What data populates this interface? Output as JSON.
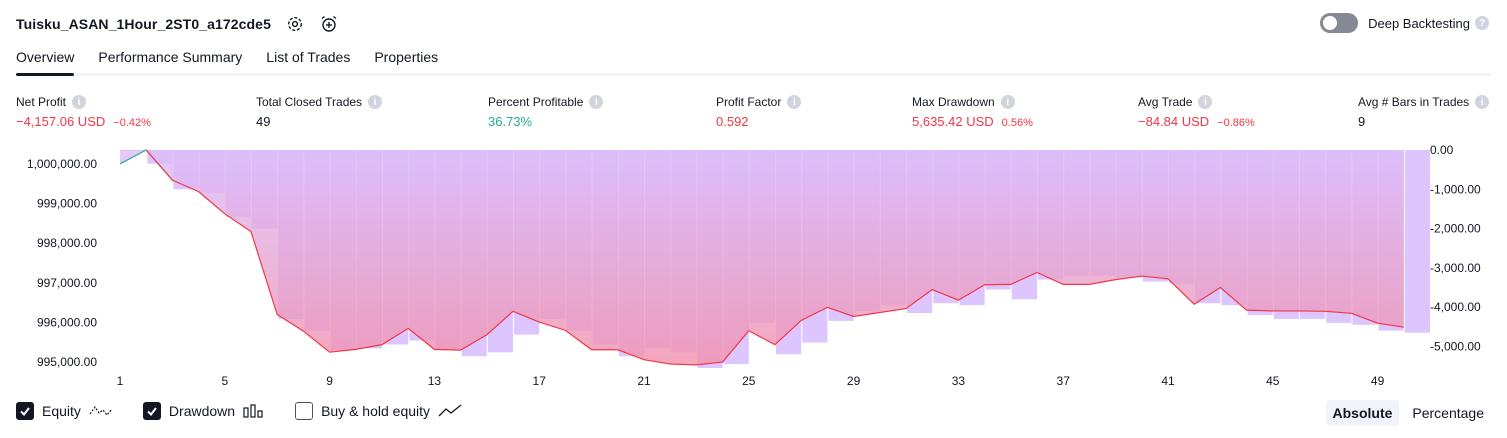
{
  "header": {
    "strategy_name": "Tuisku_ASAN_1Hour_2ST0_a172cde5",
    "settings_icon": "gear-icon",
    "alert_icon": "alarm-clock-add-icon"
  },
  "deep_backtesting": {
    "label": "Deep Backtesting",
    "enabled": false
  },
  "tabs": [
    {
      "label": "Overview",
      "active": true
    },
    {
      "label": "Performance Summary",
      "active": false
    },
    {
      "label": "List of Trades",
      "active": false
    },
    {
      "label": "Properties",
      "active": false
    }
  ],
  "metrics": [
    {
      "label": "Net Profit",
      "value": "−4,157.06 USD",
      "sub": "−0.42%",
      "color": "#f23645"
    },
    {
      "label": "Total Closed Trades",
      "value": "49",
      "sub": "",
      "color": "#131722"
    },
    {
      "label": "Percent Profitable",
      "value": "36.73%",
      "sub": "",
      "color": "#22ab94"
    },
    {
      "label": "Profit Factor",
      "value": "0.592",
      "sub": "",
      "color": "#f23645"
    },
    {
      "label": "Max Drawdown",
      "value": "5,635.42 USD",
      "sub": "0.56%",
      "color": "#f23645"
    },
    {
      "label": "Avg Trade",
      "value": "−84.84 USD",
      "sub": "−0.86%",
      "color": "#f23645"
    },
    {
      "label": "Avg # Bars in Trades",
      "value": "9",
      "sub": "",
      "color": "#131722"
    }
  ],
  "legend": {
    "equity": {
      "label": "Equity",
      "checked": true
    },
    "drawdown": {
      "label": "Drawdown",
      "checked": true
    },
    "buy_hold": {
      "label": "Buy & hold equity",
      "checked": false
    }
  },
  "mode": {
    "absolute": "Absolute",
    "percentage": "Percentage",
    "active": "Absolute"
  },
  "chart_data": {
    "type": "area",
    "x_ticks": [
      "1",
      "5",
      "9",
      "13",
      "17",
      "21",
      "25",
      "29",
      "33",
      "37",
      "41",
      "45",
      "49"
    ],
    "left_axis": {
      "ticks": [
        "1,000,000.00",
        "999,000.00",
        "998,000.00",
        "997,000.00",
        "996,000.00",
        "995,000.00"
      ],
      "range": [
        994800,
        1000350
      ]
    },
    "right_axis": {
      "ticks": [
        "0.00",
        "-1,000.00",
        "-2,000.00",
        "-3,000.00",
        "-4,000.00",
        "-5,000.00"
      ],
      "range": [
        -5600,
        0
      ]
    },
    "colors": {
      "equity_below": "#f23645",
      "equity_above": "#22ab94",
      "drawdown": "#d1b3ff",
      "fill_top": "#dcbcfb",
      "fill_bottom": "#f191ad"
    },
    "series": [
      {
        "name": "Equity",
        "x": [
          0,
          1,
          2,
          3,
          4,
          5,
          6,
          7,
          8,
          9,
          10,
          11,
          12,
          13,
          14,
          15,
          16,
          17,
          18,
          19,
          20,
          21,
          22,
          23,
          24,
          25,
          26,
          27,
          28,
          29,
          30,
          31,
          32,
          33,
          34,
          35,
          36,
          37,
          38,
          39,
          40,
          41,
          42,
          43,
          44,
          45,
          46,
          47,
          48,
          49
        ],
        "values": [
          1000000,
          1000350,
          999590,
          999300,
          998740,
          998290,
          996200,
          995780,
          995250,
          995320,
          995440,
          995850,
          995320,
          995300,
          995690,
          996280,
          996010,
          995800,
          995310,
          995310,
          995060,
          994950,
          994930,
          995000,
          995790,
          995440,
          996050,
          996380,
          996150,
          996250,
          996350,
          996830,
          996560,
          996950,
          996960,
          997260,
          996960,
          996960,
          997080,
          997170,
          997100,
          996460,
          996880,
          996310,
          996290,
          996290,
          996280,
          996230,
          995980,
          995880
        ]
      },
      {
        "name": "Drawdown",
        "values": [
          0,
          -350,
          -1000,
          -1100,
          -1700,
          -2000,
          -4300,
          -4600,
          -5100,
          -5050,
          -4950,
          -4850,
          -5100,
          -5250,
          -5150,
          -4700,
          -4300,
          -4600,
          -4950,
          -5250,
          -5050,
          -5150,
          -5550,
          -5450,
          -4400,
          -5200,
          -4900,
          -4350,
          -4100,
          -3950,
          -4150,
          -3900,
          -3950,
          -3550,
          -3800,
          -3300,
          -3200,
          -3200,
          -3250,
          -3350,
          -3400,
          -3900,
          -3950,
          -4200,
          -4300,
          -4300,
          -4400,
          -4450,
          -4600,
          -4650
        ]
      }
    ]
  }
}
